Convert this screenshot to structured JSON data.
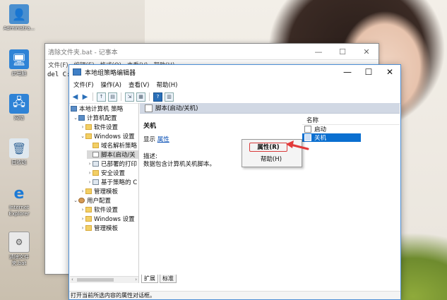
{
  "desktop": {
    "icons": [
      {
        "label": "Administra...",
        "icon": "user-icon"
      },
      {
        "label": "此电脑",
        "icon": "computer-icon"
      },
      {
        "label": "网络",
        "icon": "network-icon"
      },
      {
        "label": "回收站",
        "icon": "recycle-bin-icon"
      },
      {
        "label": "Internet Explorer",
        "icon": "ie-icon"
      },
      {
        "label": "清除文件夹.bat",
        "icon": "bat-file-icon"
      }
    ]
  },
  "notepad": {
    "title": "清除文件夹.bat - 记事本",
    "menu": [
      "文件(F)",
      "编辑(E)",
      "格式(O)",
      "查看(V)",
      "帮助(H)"
    ],
    "content": "del C:"
  },
  "gpedit": {
    "title": "本地组策略编辑器",
    "controls": {
      "minimize": "—",
      "maximize": "☐",
      "close": "✕"
    },
    "menu": [
      "文件(F)",
      "操作(A)",
      "查看(V)",
      "帮助(H)"
    ],
    "tree": [
      {
        "label": "本地计算机 策略",
        "icon": "computer-policy-icon"
      },
      {
        "label": "计算机配置",
        "icon": "computer-icon"
      },
      {
        "label": "软件设置",
        "icon": "folder-icon"
      },
      {
        "label": "Windows 设置",
        "icon": "folder-icon"
      },
      {
        "label": "域名解析策略",
        "icon": "folder-icon"
      },
      {
        "label": "脚本(启动/关",
        "icon": "script-icon"
      },
      {
        "label": "已部署的打印",
        "icon": "printer-icon"
      },
      {
        "label": "安全设置",
        "icon": "folder-icon"
      },
      {
        "label": "基于策略的 C",
        "icon": "chart-icon"
      },
      {
        "label": "管理模板",
        "icon": "folder-icon"
      },
      {
        "label": "用户配置",
        "icon": "user-icon"
      },
      {
        "label": "软件设置",
        "icon": "folder-icon"
      },
      {
        "label": "Windows 设置",
        "icon": "folder-icon"
      },
      {
        "label": "管理模板",
        "icon": "folder-icon"
      }
    ],
    "pane_header": "脚本(启动/关机)",
    "detail": {
      "title": "关机",
      "show_prefix": "显示",
      "show_link": "属性",
      "desc_label": "描述:",
      "desc_text": "数据包含计算机关机脚本。"
    },
    "list": {
      "header": "名称",
      "items": [
        "启动",
        "关机"
      ]
    },
    "tabs": [
      "扩展",
      "标准"
    ],
    "status": "打开当前所选内容的属性对话框。",
    "context_menu": {
      "properties": "属性(R)",
      "help": "帮助(H)"
    }
  },
  "colors": {
    "selection": "#0a6fd0",
    "highlight_box": "#d93b3b",
    "window_border": "#4d8fd6"
  }
}
